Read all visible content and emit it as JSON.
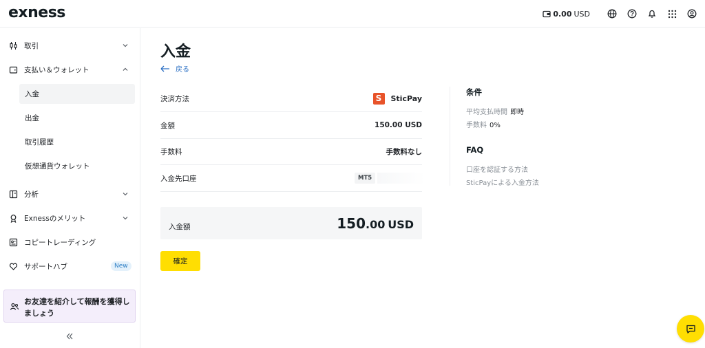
{
  "header": {
    "logo": "exness",
    "balance_amount": "0.00",
    "balance_currency": "USD",
    "icons": [
      "wallet-icon",
      "globe-icon",
      "help-icon",
      "bell-icon",
      "apps-grid-icon",
      "account-icon"
    ]
  },
  "sidebar": {
    "items": [
      {
        "label": "取引",
        "icon": "trading-icon",
        "expanded": false
      },
      {
        "label": "支払い＆ウォレット",
        "icon": "wallet-icon",
        "expanded": true
      },
      {
        "label": "分析",
        "icon": "analytics-icon",
        "expanded": false
      },
      {
        "label": "Exnessのメリット",
        "icon": "benefits-icon",
        "expanded": false
      },
      {
        "label": "コピートレーディング",
        "icon": "copy-trading-icon"
      },
      {
        "label": "サポートハブ",
        "icon": "heart-icon",
        "badge": "New"
      }
    ],
    "subitems": [
      {
        "label": "入金",
        "active": true
      },
      {
        "label": "出金",
        "active": false
      },
      {
        "label": "取引履歴",
        "active": false
      },
      {
        "label": "仮想通貨ウォレット",
        "active": false
      }
    ],
    "promo": "お友達を紹介して報酬を獲得しましょう"
  },
  "main": {
    "title": "入金",
    "back_label": "戻る",
    "rows": [
      {
        "key": "決済方法",
        "value": "SticPay"
      },
      {
        "key": "金額",
        "value": "150.00 USD"
      },
      {
        "key": "手数料",
        "value": "手数料なし"
      },
      {
        "key": "入金先口座",
        "value": "MT5"
      }
    ],
    "total": {
      "label": "入金額",
      "amount_int": "150",
      "amount_dec": ".00",
      "currency": "USD"
    },
    "confirm_label": "確定"
  },
  "conditions": {
    "title": "条件",
    "processing_label": "平均支払時間",
    "processing_value": "即時",
    "fee_label": "手数料",
    "fee_value": "0%"
  },
  "faq": {
    "title": "FAQ",
    "links": [
      "口座を認証する方法",
      "SticPayによる入金方法"
    ]
  },
  "colors": {
    "accent_yellow": "#ffde02",
    "link_blue": "#2a6fc4",
    "sticpay_orange": "#e8532a",
    "promo_bg": "#f4eefb"
  }
}
